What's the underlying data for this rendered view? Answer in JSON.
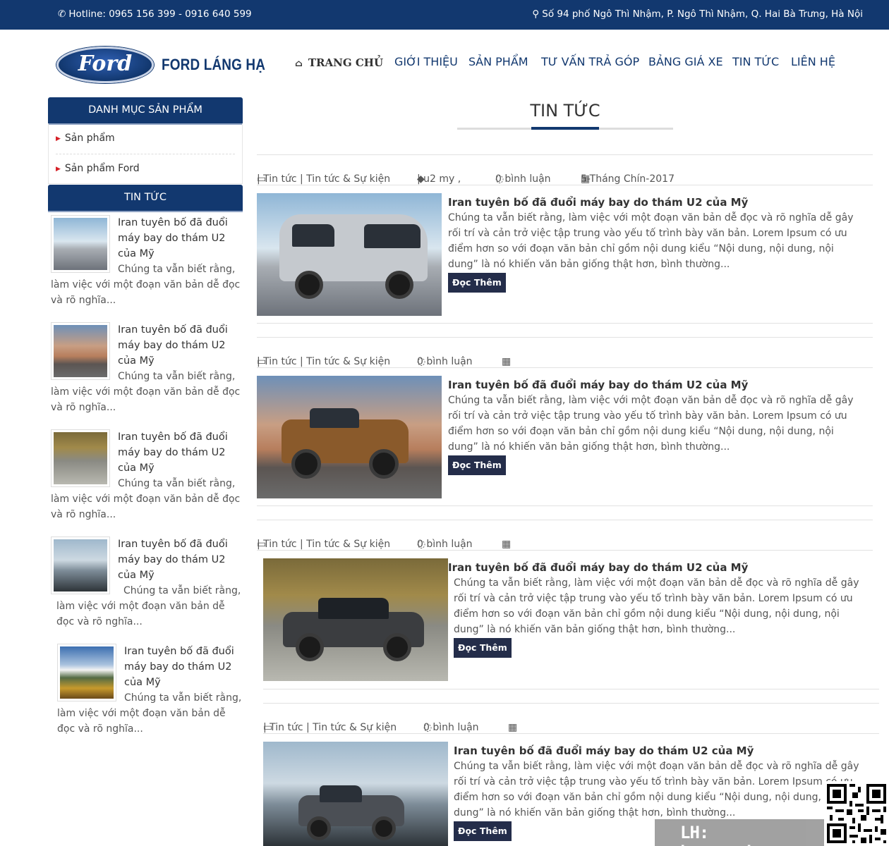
{
  "topbar": {
    "hotline": "Hotline: 0965 156 399 - 0916 640 599",
    "address": "Số 94 phố Ngô Thì Nhậm, P. Ngô Thì Nhậm, Q. Hai Bà Trưng, Hà Nội",
    "phone_icon": "phone-icon",
    "map_icon": "map-marker-icon"
  },
  "header": {
    "logo_script": "Ford",
    "brand": "FORD LÁNG HẠ"
  },
  "nav": {
    "items": [
      "TRANG CHỦ",
      "GIỚI THIỆU",
      "SẢN PHẨM",
      "TƯ VẤN TRẢ GÓP",
      "BẢNG GIÁ XE",
      "TIN TỨC",
      "LIÊN HỆ"
    ],
    "home_icon": "home-icon"
  },
  "sidebar": {
    "categories_heading": "DANH MỤC SẢN PHẨM",
    "categories": [
      "Sản phẩm",
      "Sản phẩm Ford"
    ],
    "news_heading": "TIN TỨC",
    "news": [
      {
        "title": "Iran tuyên bố đã đuổi máy bay do thám U2 của Mỹ",
        "excerpt": "Chúng ta vẫn biết rằng, làm việc với một đoạn văn bản dễ đọc và rõ nghĩa..."
      },
      {
        "title": "Iran tuyên bố đã đuổi máy bay do thám U2 của Mỹ",
        "excerpt": "Chúng ta vẫn biết rằng, làm việc với một đoạn văn bản dễ đọc và rõ nghĩa..."
      },
      {
        "title": "Iran tuyên bố đã đuổi máy bay do thám U2 của Mỹ",
        "excerpt": "Chúng ta vẫn biết rằng, làm việc với một đoạn văn bản dễ đọc và rõ nghĩa..."
      },
      {
        "title": "Iran tuyên bố đã đuổi máy bay do thám U2 của Mỹ",
        "excerpt": "Chúng ta vẫn biết rằng, làm việc với một đoạn văn bản dễ đọc và rõ nghĩa..."
      },
      {
        "title": "Iran tuyên bố đã đuổi máy bay do thám U2 của Mỹ",
        "excerpt": "Chúng ta vẫn biết rằng, làm việc với một đoạn văn bản dễ đọc và rõ nghĩa..."
      }
    ]
  },
  "main": {
    "page_title": "TIN TỨC",
    "posts": [
      {
        "meta_category": "| Tin tức | Tin tức & Sự kiện",
        "meta_tags": "| u2 my ,",
        "meta_comments": "0 bình luận",
        "meta_date": "5-Tháng Chín-2017",
        "title": "Iran tuyên bố đã đuổi máy bay do thám U2 của Mỹ",
        "excerpt": "Chúng ta vẫn biết rằng, làm việc với một đoạn văn bản dễ đọc và rõ nghĩa dễ gây rối trí và cản trở việc tập trung vào yếu tố trình bày văn bản. Lorem Ipsum có ưu điểm hơn so với đoạn văn bản chỉ gồm nội dung kiểu “Nội dung, nội dung, nội dung” là nó khiến văn bản giống thật hơn, bình thường...",
        "read_more": "Đọc Thêm"
      },
      {
        "meta_category": "| Tin tức | Tin tức & Sự kiện",
        "meta_comments": "0 bình luận",
        "title": "Iran tuyên bố đã đuổi máy bay do thám U2 của Mỹ",
        "excerpt": "Chúng ta vẫn biết rằng, làm việc với một đoạn văn bản dễ đọc và rõ nghĩa dễ gây rối trí và cản trở việc tập trung vào yếu tố trình bày văn bản. Lorem Ipsum có ưu điểm hơn so với đoạn văn bản chỉ gồm nội dung kiểu “Nội dung, nội dung, nội dung” là nó khiến văn bản giống thật hơn, bình thường...",
        "read_more": "Đọc Thêm"
      },
      {
        "meta_category": "| Tin tức | Tin tức & Sự kiện",
        "meta_comments": "0 bình luận",
        "title": "Iran tuyên bố đã đuổi máy bay do thám U2 của Mỹ",
        "excerpt": "Chúng ta vẫn biết rằng, làm việc với một đoạn văn bản dễ đọc và rõ nghĩa dễ gây rối trí và cản trở việc tập trung vào yếu tố trình bày văn bản. Lorem Ipsum có ưu điểm hơn so với đoạn văn bản chỉ gồm nội dung kiểu “Nội dung, nội dung, nội dung” là nó khiến văn bản giống thật hơn, bình thường...",
        "read_more": "Đọc Thêm"
      },
      {
        "meta_category": "| Tin tức | Tin tức & Sự kiện",
        "meta_comments": "0 bình luận",
        "title": "Iran tuyên bố đã đuổi máy bay do thám U2 của Mỹ",
        "excerpt": "Chúng ta vẫn biết rằng, làm việc với một đoạn văn bản dễ đọc và rõ nghĩa dễ gây rối trí và cản trở việc tập trung vào yếu tố trình bày văn bản. Lorem Ipsum có ưu điểm hơn so với đoạn văn bản chỉ gồm nội dung kiểu “Nội dung, nội dung, nội dung” là nó khiến văn bản giống thật hơn, bình thường...",
        "read_more": "Đọc Thêm"
      }
    ]
  },
  "watermark": {
    "text": "LH: hoangweb.net"
  },
  "colors": {
    "primary": "#12386f",
    "button": "#242d4a",
    "accent_red": "#d61f26"
  }
}
